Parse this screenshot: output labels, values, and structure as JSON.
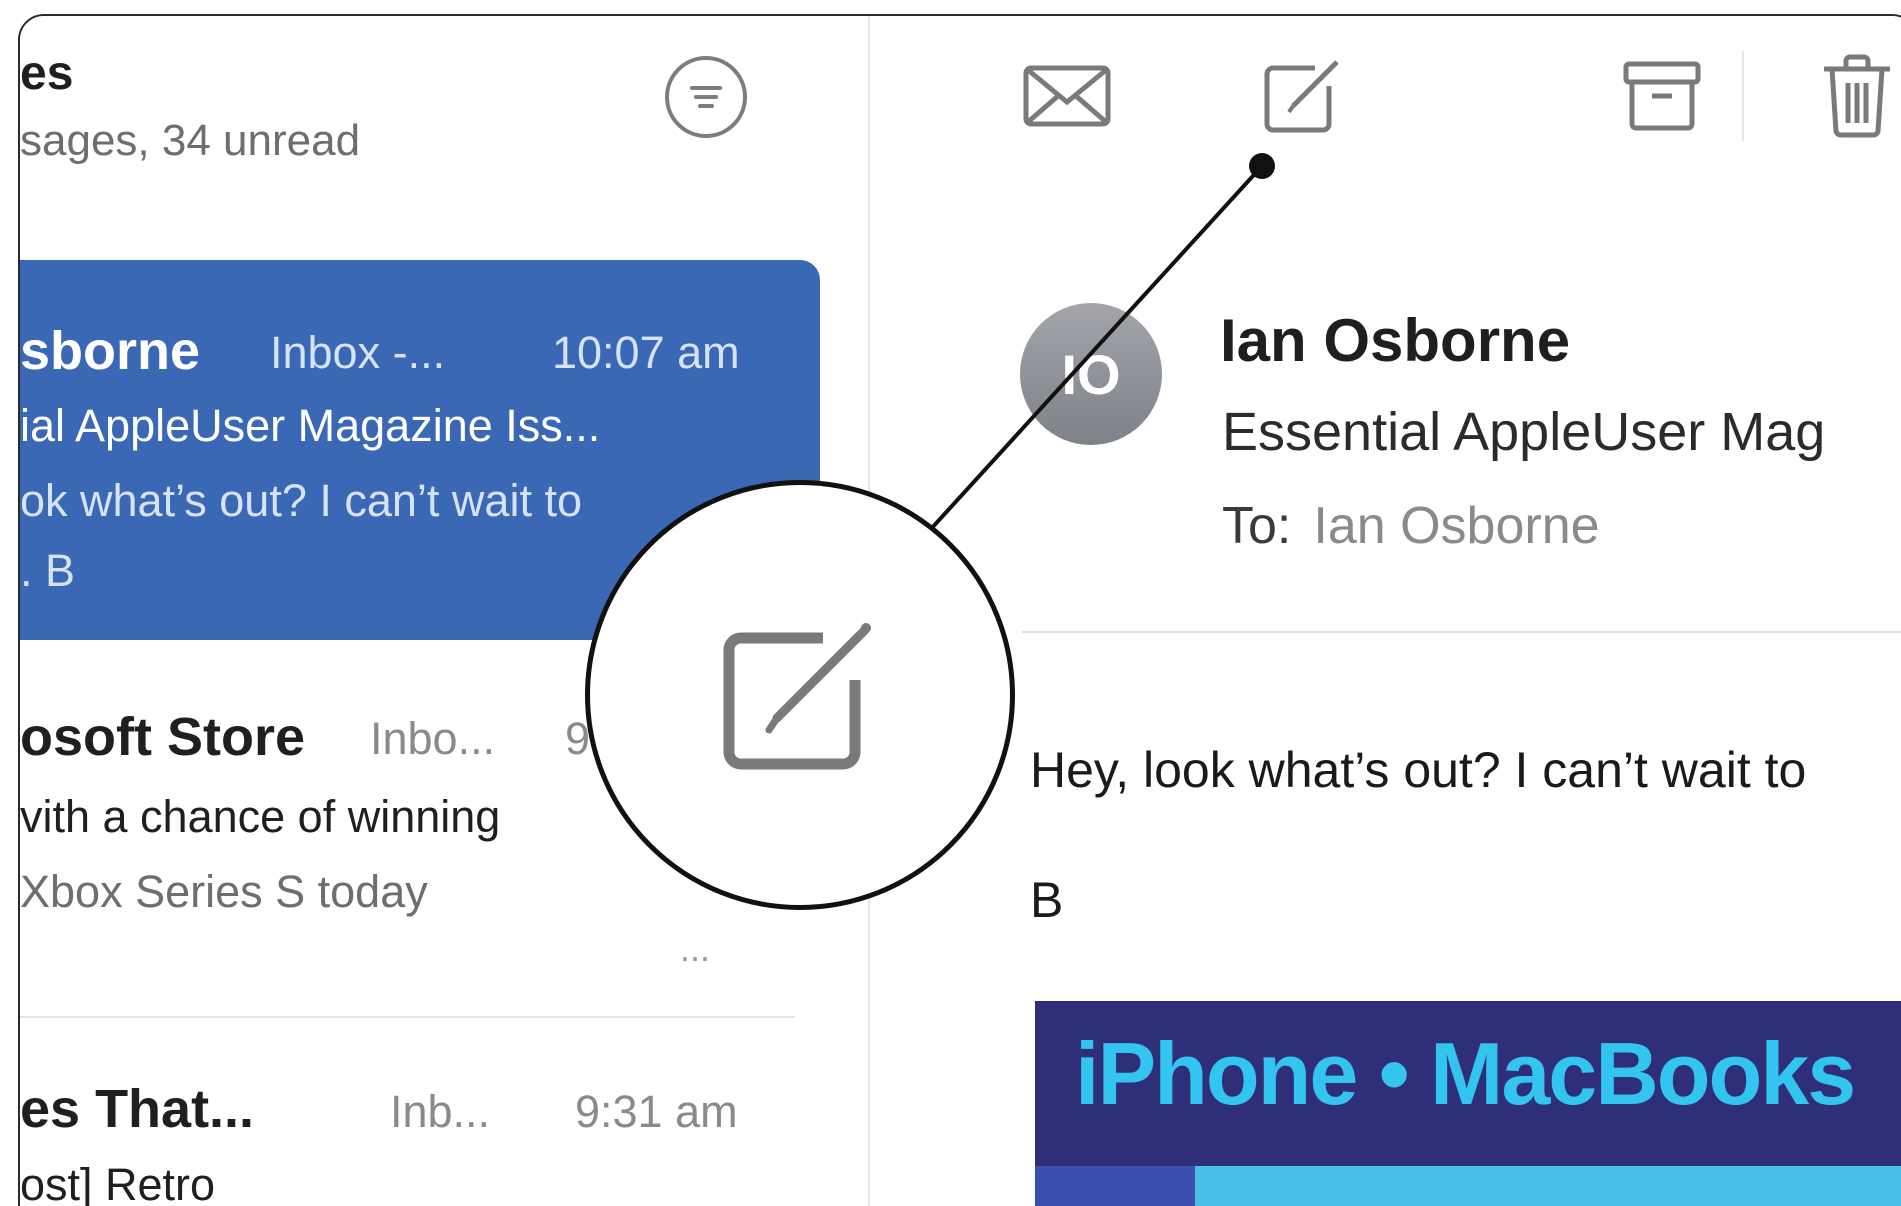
{
  "mailbox": {
    "title": "es",
    "subtitle": "sages, 34 unread"
  },
  "messages": [
    {
      "from": "sborne",
      "mailbox": "Inbox -...",
      "time": "10:07 am",
      "subject": "ial AppleUser Magazine Iss...",
      "preview": "ok what’s out? I can’t wait to",
      "preview2": ". B"
    },
    {
      "from": "osoft Store",
      "mailbox": "Inbo...",
      "time": "9",
      "subject": "vith a chance of winning",
      "preview": "Xbox Series S today",
      "more": "..."
    },
    {
      "from": "es That...",
      "mailbox": "Inb...",
      "time": "9:31 am",
      "subject": "ost] Retro"
    }
  ],
  "toolbar": {
    "icons": [
      "envelope-icon",
      "compose-icon",
      "archive-icon",
      "trash-icon"
    ]
  },
  "email": {
    "avatar_initials": "IO",
    "sender": "Ian Osborne",
    "subject": "Essential AppleUser Mag",
    "to_label": "To:",
    "to_name": "Ian Osborne",
    "body_line1": "Hey, look what’s out? I can’t wait to",
    "body_line2": "B",
    "banner_text": "iPhone • MacBooks"
  },
  "colors": {
    "selection": "#3b68b5",
    "banner_bg": "#2f2e78",
    "banner_text": "#33c4ef",
    "icon_gray": "#7a7a7a"
  }
}
